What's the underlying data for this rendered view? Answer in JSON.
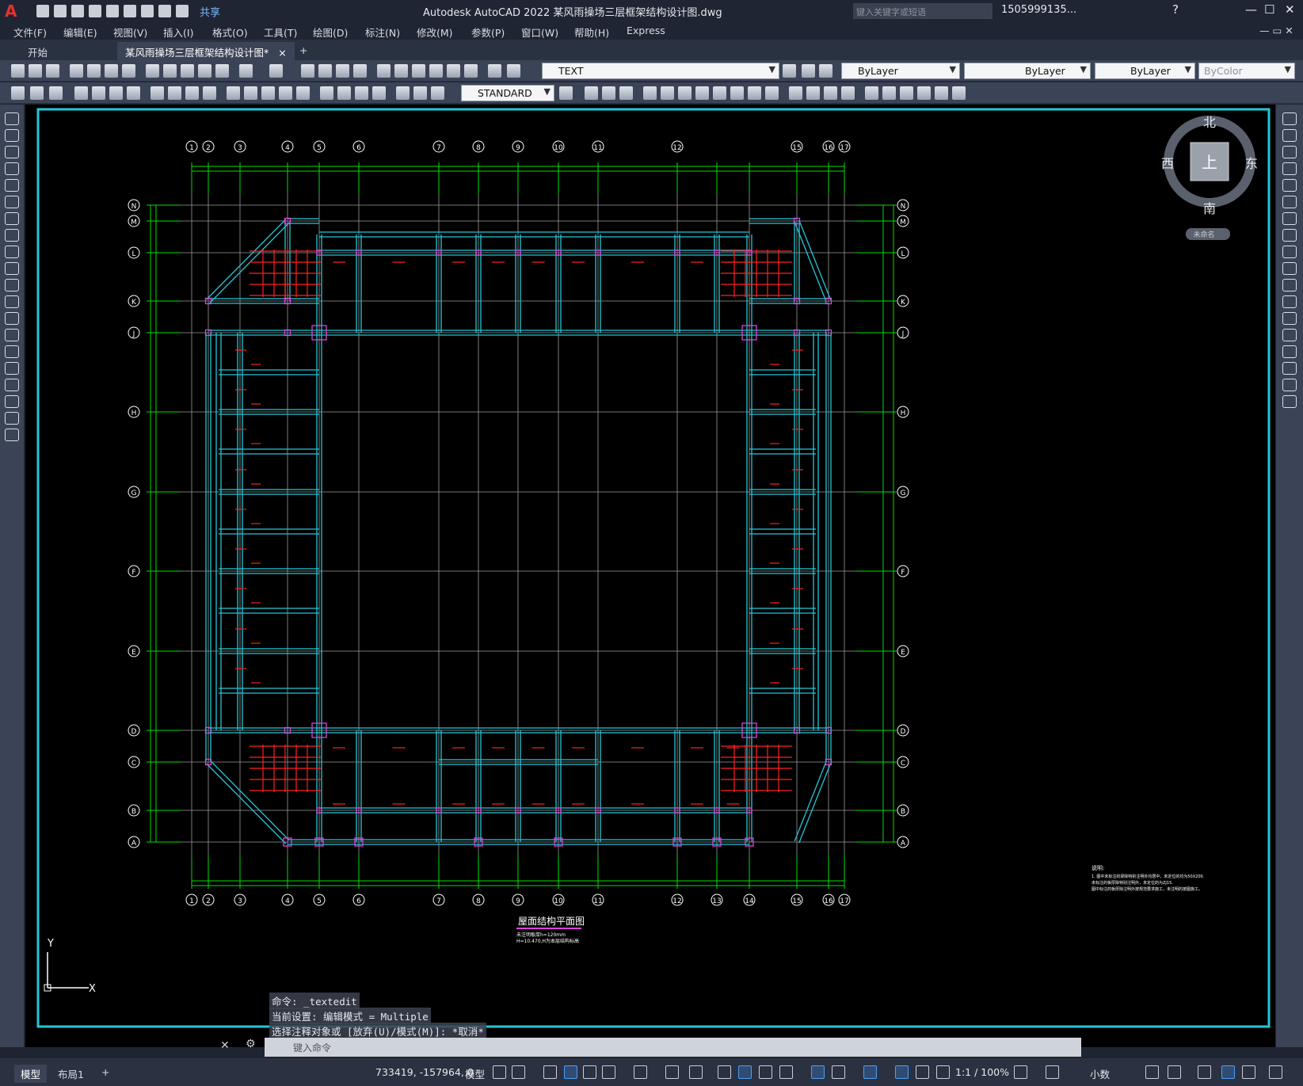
{
  "titlebar": {
    "logo": "A",
    "share": "共享",
    "title": "Autodesk AutoCAD 2022    某风雨操场三层框架结构设计图.dwg",
    "search_placeholder": "键入关键字或短语",
    "user": "1505999135...",
    "help": "?"
  },
  "menu": [
    "文件(F)",
    "编辑(E)",
    "视图(V)",
    "插入(I)",
    "格式(O)",
    "工具(T)",
    "绘图(D)",
    "标注(N)",
    "修改(M)",
    "参数(P)",
    "窗口(W)",
    "帮助(H)",
    "Express"
  ],
  "tabs": {
    "start": "开始",
    "drawing": "某风雨操场三层框架结构设计图*",
    "close": "×",
    "add": "+"
  },
  "toolbar": {
    "layer": "TEXT",
    "color": "ByLayer",
    "linetype": "ByLayer",
    "lineweight": "ByLayer",
    "plotstyle": "ByColor",
    "textstyle": "STANDARD"
  },
  "viewcube": {
    "north": "北",
    "south": "南",
    "east": "东",
    "west": "西",
    "face": "上",
    "wcs": "未命名"
  },
  "drawing": {
    "col_labels": [
      "1",
      "2",
      "3",
      "4",
      "5",
      "6",
      "7",
      "8",
      "9",
      "10",
      "11",
      "12",
      "13",
      "14",
      "15",
      "16",
      "17"
    ],
    "row_labels": [
      "A",
      "B",
      "C",
      "D",
      "E",
      "F",
      "G",
      "H",
      "J",
      "K",
      "L",
      "M",
      "N"
    ],
    "title": "屋面结构平面图",
    "subtitle1": "未注明板厚h=120mm",
    "subtitle2": "H=10.470,H为本层结构标高",
    "note_head": "说明:",
    "note1": "1. 图中未标注的梁除特别注明外均居中，未定位的均为50X200.",
    "note2": "   未标注的板厚除特别注明外，未定位的为ZJ15.",
    "note3": "   图中标注的板厚除注明外按规范要求施工，未注明的按图施工。"
  },
  "command": {
    "hist1": "命令: _textedit",
    "hist2": "当前设置: 编辑模式 = Multiple",
    "hist3": "选择注释对象或 [放弃(U)/模式(M)]: *取消*",
    "placeholder": "键入命令"
  },
  "status": {
    "model_tab": "模型",
    "layout_tab": "布局1",
    "add": "+",
    "coords": "733419, -157964, 0",
    "model": "模型",
    "scale": "1:1 / 100%",
    "units": "小数"
  },
  "colors": {
    "cyan": "#22c8d8",
    "green": "#00e000",
    "red": "#ff2020",
    "magenta": "#e040e0",
    "grid": "#9a9a9a"
  }
}
